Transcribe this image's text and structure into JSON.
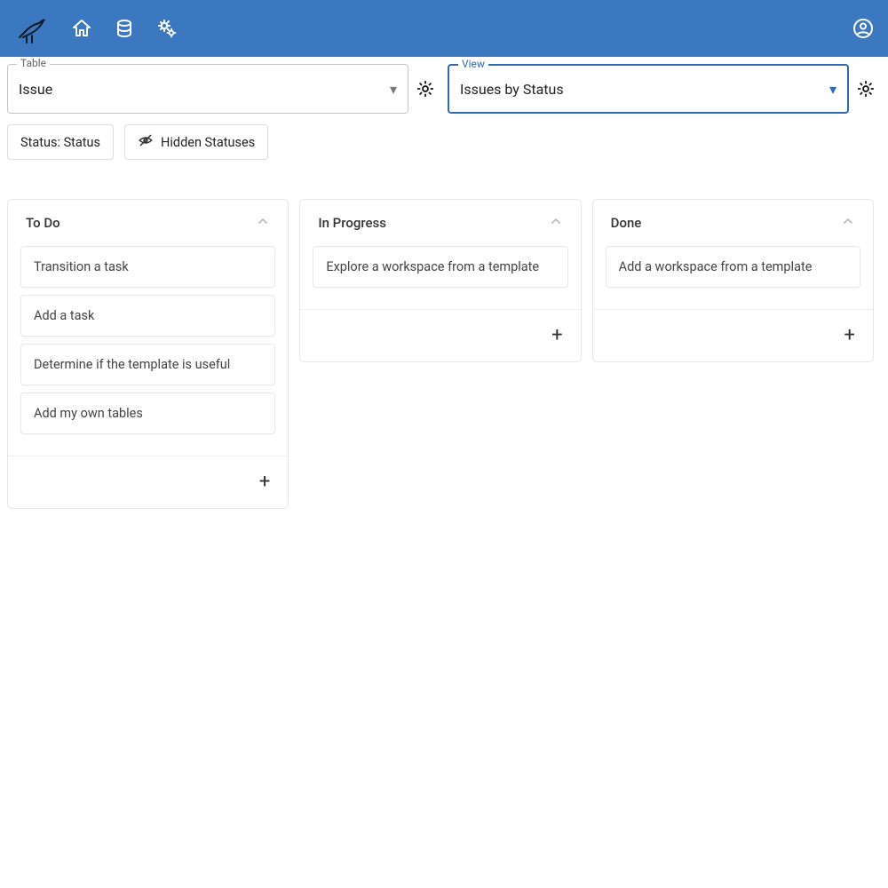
{
  "selectors": {
    "table": {
      "label": "Table",
      "value": "Issue"
    },
    "view": {
      "label": "View",
      "value": "Issues by Status"
    }
  },
  "filters": {
    "status": "Status: Status",
    "hidden": "Hidden Statuses"
  },
  "columns": [
    {
      "title": "To Do",
      "cards": [
        "Transition a task",
        "Add a task",
        "Determine if the template is useful",
        "Add my own tables"
      ]
    },
    {
      "title": "In Progress",
      "cards": [
        "Explore a workspace from a template"
      ]
    },
    {
      "title": "Done",
      "cards": [
        "Add a workspace from a template"
      ]
    }
  ]
}
